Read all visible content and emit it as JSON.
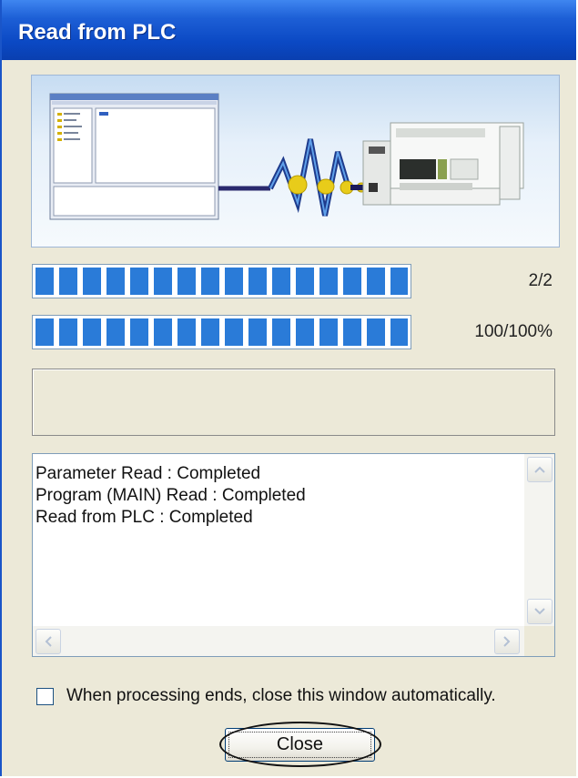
{
  "window": {
    "title": "Read from PLC"
  },
  "progress": {
    "overall": {
      "label": "2/2",
      "fraction": 1.0
    },
    "current": {
      "label": "100/100%",
      "fraction": 1.0
    }
  },
  "status_text": "",
  "log": {
    "lines": [
      "Parameter Read : Completed",
      "Program (MAIN) Read : Completed",
      "Read from PLC : Completed"
    ]
  },
  "options": {
    "auto_close_label": "When processing ends, close this window automatically.",
    "auto_close_checked": false
  },
  "buttons": {
    "close_label": "Close"
  },
  "colors": {
    "titlebar": "#0b49c4",
    "progress_fill": "#2a7bd8",
    "dialog_bg": "#ece9d8"
  },
  "icons": {
    "banner": "pc-to-plc-transfer-illustration",
    "scroll_up": "chevron-up-icon",
    "scroll_down": "chevron-down-icon",
    "scroll_left": "chevron-left-icon",
    "scroll_right": "chevron-right-icon"
  }
}
